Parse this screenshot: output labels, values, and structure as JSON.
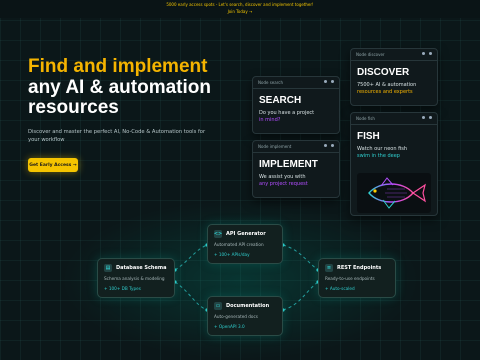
{
  "banner": {
    "line1": "5000 early access spots - Let's search, discover and implement together!",
    "line2": "Join Today →"
  },
  "hero": {
    "title_line1": "Find and implement",
    "title_line2": "any AI & automation",
    "title_line3": "resources",
    "description": "Discover and master the perfect AI, No-Code & Automation tools for your workflow",
    "cta": "Get Early Access →"
  },
  "cards": {
    "search": {
      "header": "Node search",
      "title": "SEARCH",
      "line1": "Do you have a project",
      "line2": "in mind?"
    },
    "discover": {
      "header": "Node discover",
      "title": "DISCOVER",
      "line1": "7500+ AI & automation",
      "line2": "resources and experts"
    },
    "implement": {
      "header": "Node implement",
      "title": "IMPLEMENT",
      "line1": "We assist you with",
      "line2": "any project request"
    },
    "fish": {
      "header": "Node fish",
      "title": "FISH",
      "line1": "Watch our neon fish",
      "line2": "swim in the deep"
    }
  },
  "nodes": {
    "api": {
      "title": "API Generator",
      "desc": "Automated API creation",
      "foot": "+ 100+ APIs/day",
      "icon": "code-icon"
    },
    "db": {
      "title": "Database Schema",
      "desc": "Schema analysis & modeling",
      "foot": "+ 100+ DB Types",
      "icon": "database-icon"
    },
    "rest": {
      "title": "REST Endpoints",
      "desc": "Ready-to-use endpoints",
      "foot": "+ Auto-scaled",
      "icon": "server-icon"
    },
    "docs": {
      "title": "Documentation",
      "desc": "Auto-generated docs",
      "foot": "+ OpenAPI 3.0",
      "icon": "document-icon"
    }
  },
  "colors": {
    "accent": "#f5b400",
    "purple": "#b24dff",
    "cyan": "#2fd0d0",
    "bg": "#0b1719"
  }
}
